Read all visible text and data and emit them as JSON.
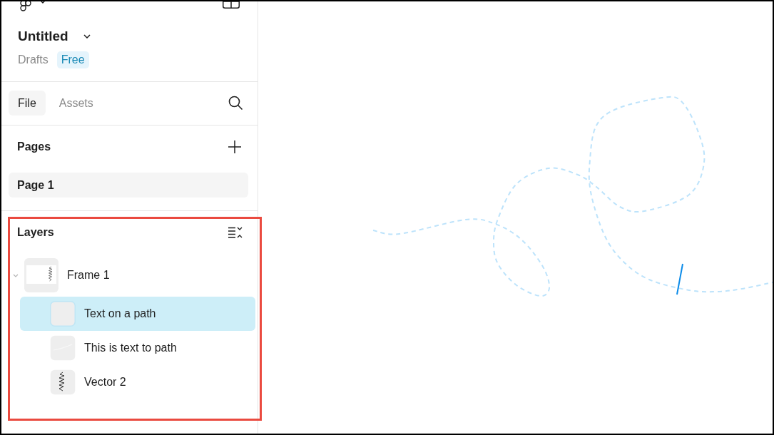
{
  "header": {
    "title": "Untitled",
    "location": "Drafts",
    "plan_badge": "Free"
  },
  "tabs": [
    {
      "label": "File",
      "selected": true
    },
    {
      "label": "Assets",
      "selected": false
    }
  ],
  "pages": {
    "heading": "Pages",
    "items": [
      {
        "label": "Page 1",
        "selected": true
      }
    ]
  },
  "layers": {
    "heading": "Layers",
    "highlighted": true,
    "items": [
      {
        "label": "Frame 1",
        "kind": "frame",
        "expanded": true,
        "selected": false,
        "children": [
          {
            "label": "Text on a path",
            "kind": "text",
            "selected": true
          },
          {
            "label": "This is text to path",
            "kind": "text-path",
            "selected": false
          },
          {
            "label": "Vector 2",
            "kind": "vector",
            "selected": false
          }
        ]
      }
    ]
  }
}
